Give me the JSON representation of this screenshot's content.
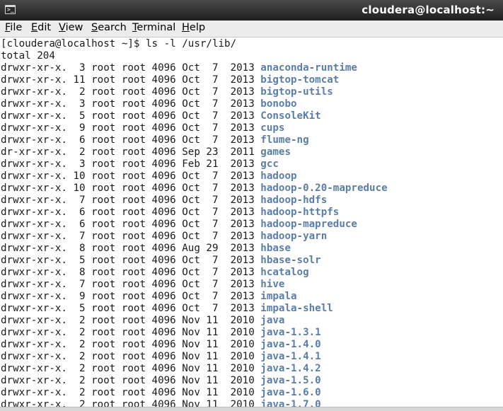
{
  "window": {
    "title": "cloudera@localhost:~",
    "icon": "terminal-icon"
  },
  "menu": [
    "File",
    "Edit",
    "View",
    "Search",
    "Terminal",
    "Help"
  ],
  "terminal": {
    "prompt": "[cloudera@localhost ~]$ ls -l /usr/lib/",
    "total": "total 204",
    "entries": [
      {
        "perms": "drwxr-xr-x.",
        "links": "3",
        "owner": "root",
        "group": "root",
        "size": "4096",
        "month": "Oct",
        "day": "7",
        "year": "2013",
        "name": "anaconda-runtime"
      },
      {
        "perms": "drwxr-xr-x.",
        "links": "11",
        "owner": "root",
        "group": "root",
        "size": "4096",
        "month": "Oct",
        "day": "7",
        "year": "2013",
        "name": "bigtop-tomcat"
      },
      {
        "perms": "drwxr-xr-x.",
        "links": "2",
        "owner": "root",
        "group": "root",
        "size": "4096",
        "month": "Oct",
        "day": "7",
        "year": "2013",
        "name": "bigtop-utils"
      },
      {
        "perms": "drwxr-xr-x.",
        "links": "3",
        "owner": "root",
        "group": "root",
        "size": "4096",
        "month": "Oct",
        "day": "7",
        "year": "2013",
        "name": "bonobo"
      },
      {
        "perms": "drwxr-xr-x.",
        "links": "5",
        "owner": "root",
        "group": "root",
        "size": "4096",
        "month": "Oct",
        "day": "7",
        "year": "2013",
        "name": "ConsoleKit"
      },
      {
        "perms": "drwxr-xr-x.",
        "links": "9",
        "owner": "root",
        "group": "root",
        "size": "4096",
        "month": "Oct",
        "day": "7",
        "year": "2013",
        "name": "cups"
      },
      {
        "perms": "drwxr-xr-x.",
        "links": "6",
        "owner": "root",
        "group": "root",
        "size": "4096",
        "month": "Oct",
        "day": "7",
        "year": "2013",
        "name": "flume-ng"
      },
      {
        "perms": "dr-xr-xr-x.",
        "links": "2",
        "owner": "root",
        "group": "root",
        "size": "4096",
        "month": "Sep",
        "day": "23",
        "year": "2011",
        "name": "games"
      },
      {
        "perms": "drwxr-xr-x.",
        "links": "3",
        "owner": "root",
        "group": "root",
        "size": "4096",
        "month": "Feb",
        "day": "21",
        "year": "2013",
        "name": "gcc"
      },
      {
        "perms": "drwxr-xr-x.",
        "links": "10",
        "owner": "root",
        "group": "root",
        "size": "4096",
        "month": "Oct",
        "day": "7",
        "year": "2013",
        "name": "hadoop"
      },
      {
        "perms": "drwxr-xr-x.",
        "links": "10",
        "owner": "root",
        "group": "root",
        "size": "4096",
        "month": "Oct",
        "day": "7",
        "year": "2013",
        "name": "hadoop-0.20-mapreduce"
      },
      {
        "perms": "drwxr-xr-x.",
        "links": "7",
        "owner": "root",
        "group": "root",
        "size": "4096",
        "month": "Oct",
        "day": "7",
        "year": "2013",
        "name": "hadoop-hdfs"
      },
      {
        "perms": "drwxr-xr-x.",
        "links": "6",
        "owner": "root",
        "group": "root",
        "size": "4096",
        "month": "Oct",
        "day": "7",
        "year": "2013",
        "name": "hadoop-httpfs"
      },
      {
        "perms": "drwxr-xr-x.",
        "links": "6",
        "owner": "root",
        "group": "root",
        "size": "4096",
        "month": "Oct",
        "day": "7",
        "year": "2013",
        "name": "hadoop-mapreduce"
      },
      {
        "perms": "drwxr-xr-x.",
        "links": "7",
        "owner": "root",
        "group": "root",
        "size": "4096",
        "month": "Oct",
        "day": "7",
        "year": "2013",
        "name": "hadoop-yarn"
      },
      {
        "perms": "drwxr-xr-x.",
        "links": "8",
        "owner": "root",
        "group": "root",
        "size": "4096",
        "month": "Aug",
        "day": "29",
        "year": "2013",
        "name": "hbase"
      },
      {
        "perms": "drwxr-xr-x.",
        "links": "5",
        "owner": "root",
        "group": "root",
        "size": "4096",
        "month": "Oct",
        "day": "7",
        "year": "2013",
        "name": "hbase-solr"
      },
      {
        "perms": "drwxr-xr-x.",
        "links": "8",
        "owner": "root",
        "group": "root",
        "size": "4096",
        "month": "Oct",
        "day": "7",
        "year": "2013",
        "name": "hcatalog"
      },
      {
        "perms": "drwxr-xr-x.",
        "links": "7",
        "owner": "root",
        "group": "root",
        "size": "4096",
        "month": "Oct",
        "day": "7",
        "year": "2013",
        "name": "hive"
      },
      {
        "perms": "drwxr-xr-x.",
        "links": "9",
        "owner": "root",
        "group": "root",
        "size": "4096",
        "month": "Oct",
        "day": "7",
        "year": "2013",
        "name": "impala"
      },
      {
        "perms": "drwxr-xr-x.",
        "links": "5",
        "owner": "root",
        "group": "root",
        "size": "4096",
        "month": "Oct",
        "day": "7",
        "year": "2013",
        "name": "impala-shell"
      },
      {
        "perms": "drwxr-xr-x.",
        "links": "2",
        "owner": "root",
        "group": "root",
        "size": "4096",
        "month": "Nov",
        "day": "11",
        "year": "2010",
        "name": "java"
      },
      {
        "perms": "drwxr-xr-x.",
        "links": "2",
        "owner": "root",
        "group": "root",
        "size": "4096",
        "month": "Nov",
        "day": "11",
        "year": "2010",
        "name": "java-1.3.1"
      },
      {
        "perms": "drwxr-xr-x.",
        "links": "2",
        "owner": "root",
        "group": "root",
        "size": "4096",
        "month": "Nov",
        "day": "11",
        "year": "2010",
        "name": "java-1.4.0"
      },
      {
        "perms": "drwxr-xr-x.",
        "links": "2",
        "owner": "root",
        "group": "root",
        "size": "4096",
        "month": "Nov",
        "day": "11",
        "year": "2010",
        "name": "java-1.4.1"
      },
      {
        "perms": "drwxr-xr-x.",
        "links": "2",
        "owner": "root",
        "group": "root",
        "size": "4096",
        "month": "Nov",
        "day": "11",
        "year": "2010",
        "name": "java-1.4.2"
      },
      {
        "perms": "drwxr-xr-x.",
        "links": "2",
        "owner": "root",
        "group": "root",
        "size": "4096",
        "month": "Nov",
        "day": "11",
        "year": "2010",
        "name": "java-1.5.0"
      },
      {
        "perms": "drwxr-xr-x.",
        "links": "2",
        "owner": "root",
        "group": "root",
        "size": "4096",
        "month": "Nov",
        "day": "11",
        "year": "2010",
        "name": "java-1.6.0"
      },
      {
        "perms": "drwxr-xr-x.",
        "links": "2",
        "owner": "root",
        "group": "root",
        "size": "4096",
        "month": "Nov",
        "day": "11",
        "year": "2010",
        "name": "java-1.7.0"
      }
    ]
  },
  "colors": {
    "directory": "#5b7ea9",
    "text": "#1a1a1a",
    "background": "#ffffff",
    "titlebar": "#2b2b2b"
  }
}
